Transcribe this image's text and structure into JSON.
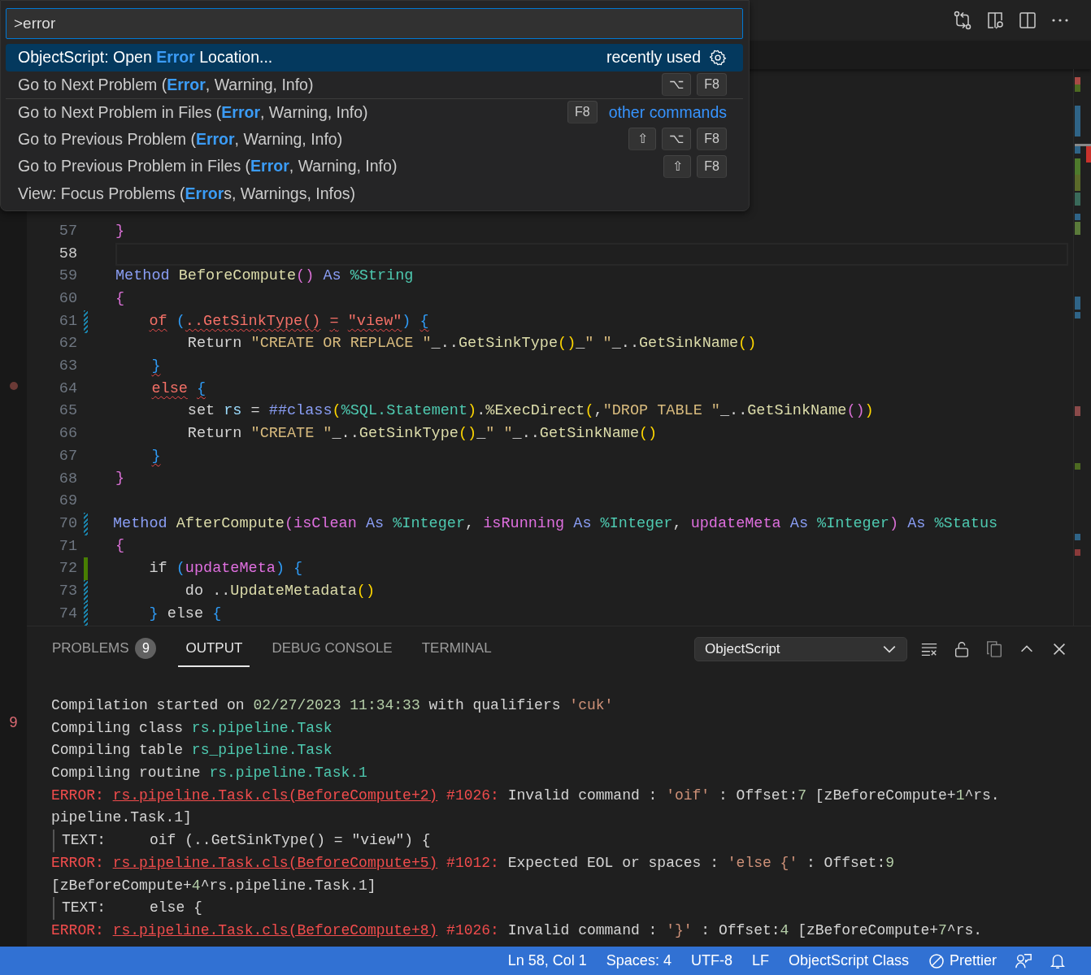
{
  "command_palette": {
    "value": ">error",
    "items": [
      {
        "label": "ObjectScript: Open **Error** Location...",
        "selected": true,
        "separator_above": false,
        "tag": "recently used"
      },
      {
        "label": "Go to Next Problem (**Error**, Warning, Info)",
        "selected": false,
        "separator_above": false,
        "keys": [
          "⌥",
          "F8"
        ]
      },
      {
        "label": "Go to Next Problem in Files (**Error**, Warning, Info)",
        "selected": false,
        "separator_above": true,
        "keys": [
          "F8"
        ],
        "group_label": "other commands"
      },
      {
        "label": "Go to Previous Problem (**Error**, Warning, Info)",
        "selected": false,
        "separator_above": false,
        "keys": [
          "⇧",
          "⌥",
          "F8"
        ]
      },
      {
        "label": "Go to Previous Problem in Files (**Error**, Warning, Info)",
        "selected": false,
        "separator_above": false,
        "keys": [
          "⇧",
          "F8"
        ]
      },
      {
        "label": "View: Focus Problems (**Error**s, Warnings, Infos)",
        "selected": false,
        "separator_above": false
      }
    ]
  },
  "sidebar_fragment": {
    "text": "9"
  },
  "editor": {
    "lines": [
      {
        "number": "57",
        "kind": "unchanged",
        "current": false,
        "tokens": [
          {
            "text": "}",
            "kind": "br2"
          }
        ]
      },
      {
        "number": "58",
        "kind": "unchanged",
        "current": true
      },
      {
        "number": "59",
        "kind": "unchanged",
        "current": false,
        "tokens": [
          {
            "text": "Method ",
            "kind": "kw"
          },
          {
            "text": "BeforeCompute",
            "kind": "fn"
          },
          {
            "text": "()",
            "kind": "br2"
          },
          {
            "text": " As ",
            "kind": "kw"
          },
          {
            "text": "%String",
            "kind": "type"
          }
        ]
      },
      {
        "number": "60",
        "kind": "unchanged",
        "current": false,
        "tokens": [
          {
            "text": "{",
            "kind": "br2"
          }
        ]
      },
      {
        "number": "61",
        "kind": "modified",
        "current": false,
        "tokens": [
          {
            "text": "    of",
            "kind": "bad"
          },
          {
            "text": " (",
            "kind": "br3"
          },
          {
            "text": "..GetSinkType()",
            "kind": "bad"
          },
          {
            "text": " =",
            "kind": "bad"
          },
          {
            "text": " \"view\"",
            "kind": "bad"
          },
          {
            "text": ")",
            "kind": "br3"
          },
          {
            "text": " {",
            "kind": "bad-br3"
          }
        ]
      },
      {
        "number": "62",
        "kind": "unchanged",
        "current": false,
        "tokens": [
          {
            "text": "        Return ",
            "kind": "plain"
          },
          {
            "text": "\"CREATE OR REPLACE \"",
            "kind": "str"
          },
          {
            "text": "_..",
            "kind": "plain"
          },
          {
            "text": "GetSinkType",
            "kind": "fn"
          },
          {
            "text": "()",
            "kind": "br1"
          },
          {
            "text": "_",
            "kind": "plain"
          },
          {
            "text": "\" \"",
            "kind": "str"
          },
          {
            "text": "_..",
            "kind": "plain"
          },
          {
            "text": "GetSinkName",
            "kind": "fn"
          },
          {
            "text": "()",
            "kind": "br1"
          }
        ]
      },
      {
        "number": "63",
        "kind": "unchanged",
        "current": false,
        "tokens": [
          {
            "text": "    }",
            "kind": "bad-br3"
          }
        ]
      },
      {
        "number": "64",
        "kind": "unchanged",
        "current": false,
        "tokens": [
          {
            "text": "    else",
            "kind": "bad"
          },
          {
            "text": " {",
            "kind": "bad-br3"
          }
        ]
      },
      {
        "number": "65",
        "kind": "unchanged",
        "current": false,
        "tokens": [
          {
            "text": "        set ",
            "kind": "plain"
          },
          {
            "text": "rs",
            "kind": "var"
          },
          {
            "text": " = ",
            "kind": "plain"
          },
          {
            "text": "##class",
            "kind": "kw"
          },
          {
            "text": "(",
            "kind": "br1"
          },
          {
            "text": "%SQL.Statement",
            "kind": "type"
          },
          {
            "text": ")",
            "kind": "br1"
          },
          {
            "text": ".",
            "kind": "plain"
          },
          {
            "text": "%ExecDirect",
            "kind": "fn"
          },
          {
            "text": "(",
            "kind": "br1"
          },
          {
            "text": ",",
            "kind": "plain"
          },
          {
            "text": "\"DROP TABLE \"",
            "kind": "str"
          },
          {
            "text": "_..",
            "kind": "plain"
          },
          {
            "text": "GetSinkName",
            "kind": "fn"
          },
          {
            "text": "()",
            "kind": "br2"
          },
          {
            "text": ")",
            "kind": "br1"
          }
        ]
      },
      {
        "number": "66",
        "kind": "unchanged",
        "current": false,
        "tokens": [
          {
            "text": "        Return ",
            "kind": "plain"
          },
          {
            "text": "\"CREATE \"",
            "kind": "str"
          },
          {
            "text": "_..",
            "kind": "plain"
          },
          {
            "text": "GetSinkType",
            "kind": "fn"
          },
          {
            "text": "()",
            "kind": "br1"
          },
          {
            "text": "_",
            "kind": "plain"
          },
          {
            "text": "\" \"",
            "kind": "str"
          },
          {
            "text": "_..",
            "kind": "plain"
          },
          {
            "text": "GetSinkName",
            "kind": "fn"
          },
          {
            "text": "()",
            "kind": "br1"
          }
        ]
      },
      {
        "number": "67",
        "kind": "unchanged",
        "current": false,
        "tokens": [
          {
            "text": "    }",
            "kind": "bad-br3"
          }
        ]
      },
      {
        "number": "68",
        "kind": "unchanged",
        "current": false,
        "tokens": [
          {
            "text": "}",
            "kind": "br2"
          }
        ]
      },
      {
        "number": "69",
        "kind": "unchanged",
        "current": false
      },
      {
        "number": "70",
        "kind": "modified",
        "current": false,
        "tokens": [
          {
            "text": "Method ",
            "kind": "kw"
          },
          {
            "text": "AfterCompute",
            "kind": "fn"
          },
          {
            "text": "(",
            "kind": "br2"
          },
          {
            "text": "isClean",
            "kind": "param"
          },
          {
            "text": " As ",
            "kind": "kw"
          },
          {
            "text": "%Integer",
            "kind": "type"
          },
          {
            "text": ", ",
            "kind": "plain"
          },
          {
            "text": "isRunning",
            "kind": "param"
          },
          {
            "text": " As ",
            "kind": "kw"
          },
          {
            "text": "%Integer",
            "kind": "type"
          },
          {
            "text": ", ",
            "kind": "plain"
          },
          {
            "text": "updateMeta",
            "kind": "param"
          },
          {
            "text": " As ",
            "kind": "kw"
          },
          {
            "text": "%Integer",
            "kind": "type"
          },
          {
            "text": ")",
            "kind": "br2"
          },
          {
            "text": " As ",
            "kind": "kw"
          },
          {
            "text": "%Status",
            "kind": "type"
          }
        ]
      },
      {
        "number": "71",
        "kind": "unchanged",
        "current": false,
        "tokens": [
          {
            "text": "{",
            "kind": "br2"
          }
        ]
      },
      {
        "number": "72",
        "kind": "added",
        "current": false,
        "tokens": [
          {
            "text": "    if ",
            "kind": "plain"
          },
          {
            "text": "(",
            "kind": "br3"
          },
          {
            "text": "updateMeta",
            "kind": "param"
          },
          {
            "text": ")",
            "kind": "br3"
          },
          {
            "text": " {",
            "kind": "br3"
          }
        ]
      },
      {
        "number": "73",
        "kind": "modified",
        "current": false,
        "tokens": [
          {
            "text": "        do ..",
            "kind": "plain"
          },
          {
            "text": "UpdateMetadata",
            "kind": "fn"
          },
          {
            "text": "()",
            "kind": "br1"
          }
        ]
      },
      {
        "number": "74",
        "kind": "modified",
        "current": false,
        "tokens": [
          {
            "text": "    }",
            "kind": "br3"
          },
          {
            "text": " else ",
            "kind": "plain"
          },
          {
            "text": "{",
            "kind": "br3"
          }
        ]
      }
    ]
  },
  "panel": {
    "tabs": [
      {
        "label": "PROBLEMS",
        "selected": false,
        "count": "9"
      },
      {
        "label": "OUTPUT",
        "selected": true
      },
      {
        "label": "DEBUG CONSOLE",
        "selected": false
      },
      {
        "label": "TERMINAL",
        "selected": false
      }
    ],
    "channel": "ObjectScript",
    "output": [
      {
        "kind": "log",
        "tokens": [
          {
            "text": "Compilation started on ",
            "kind": "plain"
          },
          {
            "text": "02/27/2023 11:34:33",
            "kind": "num"
          },
          {
            "text": " with qualifiers ",
            "kind": "plain"
          },
          {
            "text": "'cuk'",
            "kind": "str"
          }
        ]
      },
      {
        "kind": "log",
        "tokens": [
          {
            "text": "Compiling class ",
            "kind": "plain"
          },
          {
            "text": "rs.pipeline.Task",
            "kind": "cls"
          }
        ]
      },
      {
        "kind": "log",
        "tokens": [
          {
            "text": "Compiling table ",
            "kind": "plain"
          },
          {
            "text": "rs_pipeline.Task",
            "kind": "cls"
          }
        ]
      },
      {
        "kind": "log",
        "tokens": [
          {
            "text": "Compiling routine ",
            "kind": "plain"
          },
          {
            "text": "rs.pipeline.Task.1",
            "kind": "cls"
          }
        ]
      },
      {
        "kind": "log",
        "tokens": [
          {
            "text": "ERROR: ",
            "kind": "err"
          },
          {
            "text": "rs.pipeline.Task.cls(BeforeCompute+2)",
            "kind": "link"
          },
          {
            "text": " #1026:",
            "kind": "err"
          },
          {
            "text": " Invalid command : ",
            "kind": "plain"
          },
          {
            "text": "'oif'",
            "kind": "str"
          },
          {
            "text": " : Offset:",
            "kind": "plain"
          },
          {
            "text": "7",
            "kind": "num"
          },
          {
            "text": " [zBeforeCompute+",
            "kind": "plain"
          },
          {
            "text": "1",
            "kind": "num"
          },
          {
            "text": "^rs.",
            "kind": "plain"
          }
        ]
      },
      {
        "kind": "log",
        "tokens": [
          {
            "text": "pipeline.Task.1]",
            "kind": "plain"
          }
        ]
      },
      {
        "kind": "source",
        "tokens": [
          {
            "text": "TEXT:     oif (..GetSinkType() = \"view\") {",
            "kind": "plain"
          }
        ]
      },
      {
        "kind": "log",
        "tokens": [
          {
            "text": "ERROR: ",
            "kind": "err"
          },
          {
            "text": "rs.pipeline.Task.cls(BeforeCompute+5)",
            "kind": "link"
          },
          {
            "text": " #1012:",
            "kind": "err"
          },
          {
            "text": " Expected EOL or spaces : ",
            "kind": "plain"
          },
          {
            "text": "'else {'",
            "kind": "str"
          },
          {
            "text": " : Offset:",
            "kind": "plain"
          },
          {
            "text": "9",
            "kind": "num"
          }
        ]
      },
      {
        "kind": "log",
        "tokens": [
          {
            "text": "[zBeforeCompute+",
            "kind": "plain"
          },
          {
            "text": "4",
            "kind": "num"
          },
          {
            "text": "^rs.pipeline.Task.1]",
            "kind": "plain"
          }
        ]
      },
      {
        "kind": "source",
        "tokens": [
          {
            "text": "TEXT:     else {",
            "kind": "plain"
          }
        ]
      },
      {
        "kind": "log",
        "tokens": [
          {
            "text": "ERROR: ",
            "kind": "err"
          },
          {
            "text": "rs.pipeline.Task.cls(BeforeCompute+8)",
            "kind": "link"
          },
          {
            "text": " #1026:",
            "kind": "err"
          },
          {
            "text": " Invalid command : ",
            "kind": "plain"
          },
          {
            "text": "'}'",
            "kind": "str"
          },
          {
            "text": " : Offset:",
            "kind": "plain"
          },
          {
            "text": "4",
            "kind": "num"
          },
          {
            "text": " [zBeforeCompute+",
            "kind": "plain"
          },
          {
            "text": "7",
            "kind": "num"
          },
          {
            "text": "^rs.",
            "kind": "plain"
          }
        ]
      }
    ]
  },
  "status_bar": {
    "items": [
      {
        "text": "Ln 58, Col 1",
        "kind": "text"
      },
      {
        "text": "Spaces: 4",
        "kind": "text"
      },
      {
        "text": "UTF-8",
        "kind": "text"
      },
      {
        "text": "LF",
        "kind": "text"
      },
      {
        "text": "ObjectScript Class",
        "kind": "text"
      },
      {
        "text": "Prettier",
        "kind": "disabled-extension"
      }
    ]
  }
}
